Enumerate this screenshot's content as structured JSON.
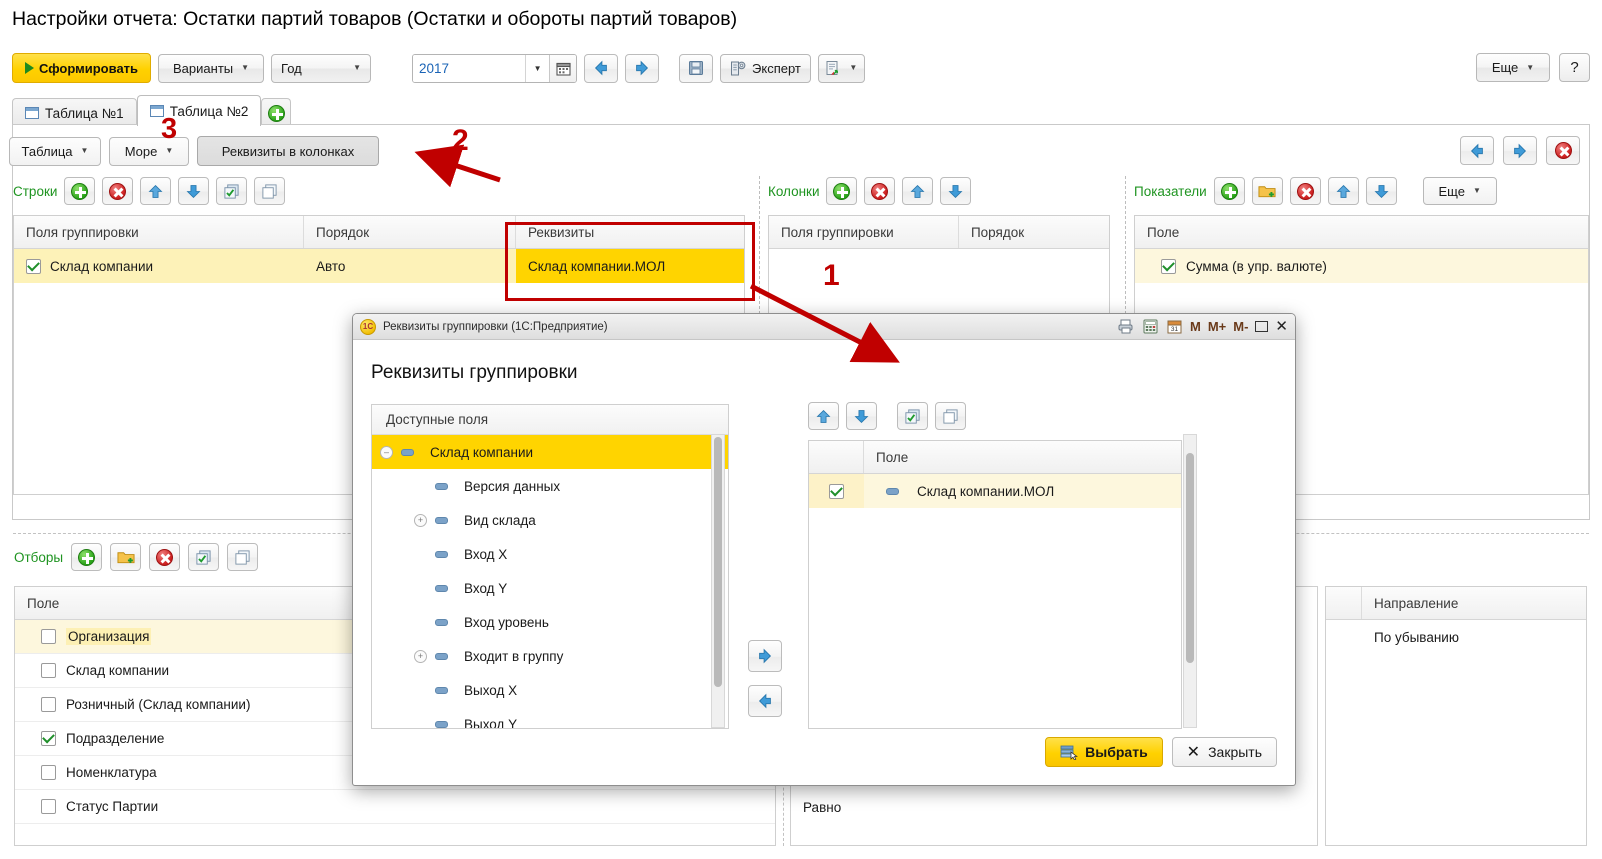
{
  "page_title": "Настройки отчета: Остатки партий товаров (Остатки и обороты партий товаров)",
  "toolbar": {
    "generate": "Сформировать",
    "variants": "Варианты",
    "period_preset": "Год",
    "period_value": "2017",
    "expert": "Эксперт",
    "more": "Еще",
    "help": "?",
    "icons": {
      "play": "play-icon",
      "calendar": "calendar-icon",
      "back": "arrow-left-icon",
      "forward": "arrow-right-icon",
      "save": "save-icon",
      "expert": "expert-icon",
      "export": "export-icon"
    }
  },
  "tabs": [
    {
      "label": "Таблица №1",
      "active": false
    },
    {
      "label": "Таблица №2",
      "active": true
    }
  ],
  "tab_add_label": "+",
  "panel_toolbar": {
    "table": "Таблица",
    "more": "Море",
    "attributes_in_columns": "Реквизиты в колонках"
  },
  "sections": {
    "rows": {
      "title": "Строки",
      "columns": [
        "Поля группировки",
        "Порядок"
      ],
      "attributes_column": "Реквизиты",
      "rows": [
        {
          "checked": true,
          "field": "Склад компании",
          "order": "Авто",
          "attribute": "Склад компании.МОЛ"
        }
      ]
    },
    "columns": {
      "title": "Колонки",
      "columns": [
        "Поля группировки",
        "Порядок"
      ],
      "rows": []
    },
    "indicators": {
      "title": "Показатели",
      "columns": [
        "Поле"
      ],
      "more": "Еще",
      "rows": [
        {
          "checked": true,
          "field": "Сумма (в упр. валюте)"
        }
      ]
    }
  },
  "filters": {
    "title": "Отборы",
    "column_field": "Поле",
    "column_direction": "Направление",
    "rows": [
      {
        "checked": false,
        "field": "Организация",
        "highlighted": true,
        "comparison": ""
      },
      {
        "checked": false,
        "field": "Склад компании",
        "highlighted": false,
        "comparison": ""
      },
      {
        "checked": false,
        "field": "Розничный (Склад компании)",
        "highlighted": false,
        "comparison": ""
      },
      {
        "checked": true,
        "field": "Подразделение",
        "highlighted": false,
        "comparison": ""
      },
      {
        "checked": false,
        "field": "Номенклатура",
        "highlighted": false,
        "comparison": ""
      },
      {
        "checked": false,
        "field": "Статус Партии",
        "highlighted": false,
        "comparison": "Равно"
      }
    ],
    "direction_rows": [
      "По убыванию"
    ]
  },
  "dialog": {
    "titlebar": "Реквизиты группировки  (1С:Предприятие)",
    "heading": "Реквизиты группировки",
    "available_header": "Доступные поля",
    "selected_header": "Поле",
    "memory_buttons": [
      "M",
      "M+",
      "M-"
    ],
    "tree": [
      {
        "label": "Склад компании",
        "level": 0,
        "expander": "minus",
        "selected": true
      },
      {
        "label": "Версия данных",
        "level": 1,
        "expander": "none",
        "selected": false
      },
      {
        "label": "Вид склада",
        "level": 1,
        "expander": "plus",
        "selected": false
      },
      {
        "label": "Вход X",
        "level": 1,
        "expander": "none",
        "selected": false
      },
      {
        "label": "Вход Y",
        "level": 1,
        "expander": "none",
        "selected": false
      },
      {
        "label": "Вход уровень",
        "level": 1,
        "expander": "none",
        "selected": false
      },
      {
        "label": "Входит в группу",
        "level": 1,
        "expander": "plus",
        "selected": false
      },
      {
        "label": "Выход X",
        "level": 1,
        "expander": "none",
        "selected": false
      },
      {
        "label": "Выход Y",
        "level": 1,
        "expander": "none",
        "selected": false
      }
    ],
    "selected_rows": [
      {
        "checked": true,
        "label": "Склад компании.МОЛ"
      }
    ],
    "choose": "Выбрать",
    "close": "Закрыть"
  },
  "annotations": {
    "one": "1",
    "two": "2",
    "three": "3",
    "accent_color": "#c00000"
  }
}
